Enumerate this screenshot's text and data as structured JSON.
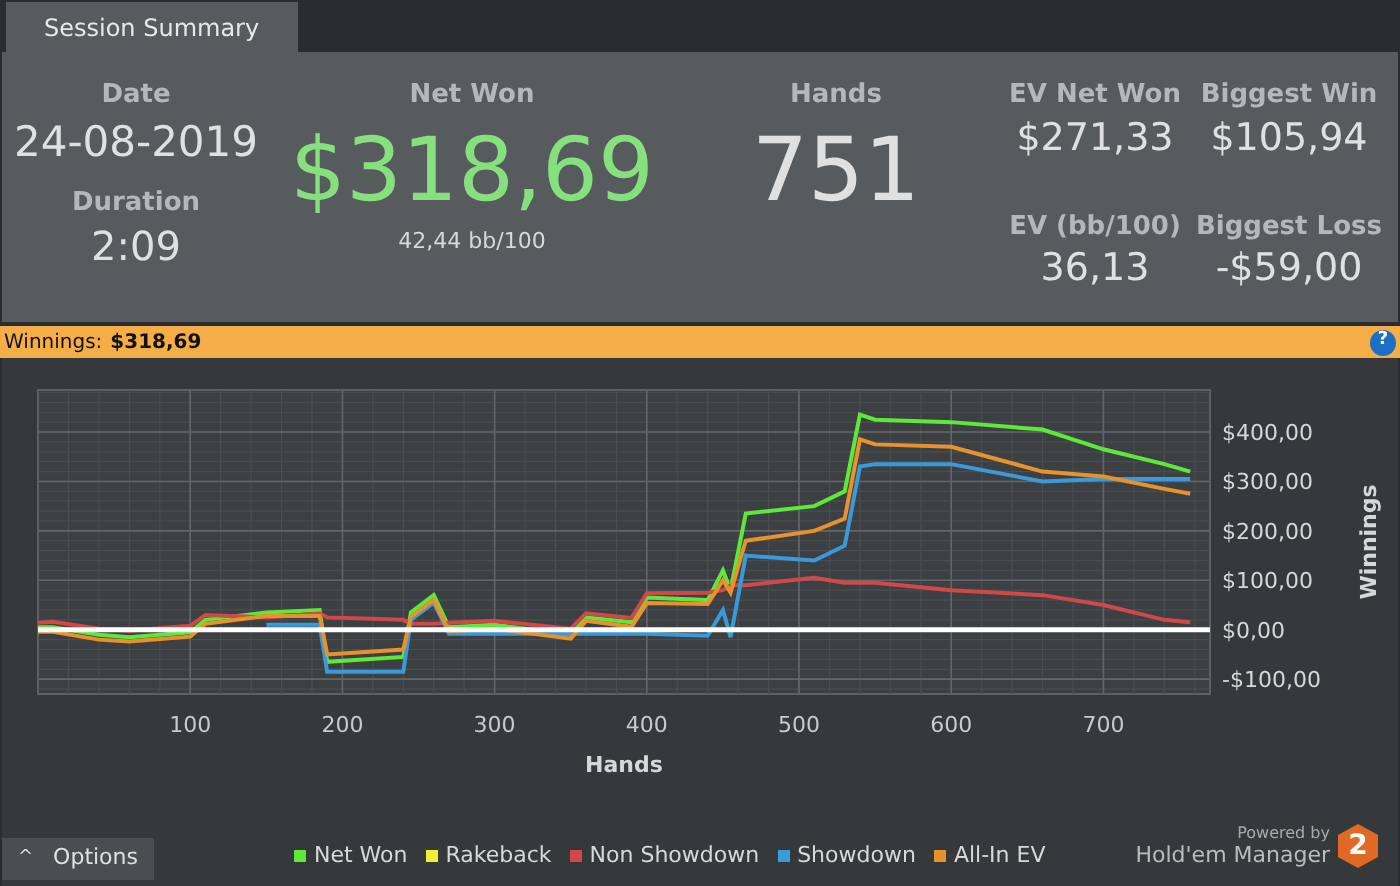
{
  "tabs": [
    {
      "label": "Session Summary",
      "selected": true
    }
  ],
  "summary": {
    "date": {
      "label": "Date",
      "value": "24-08-2019"
    },
    "duration": {
      "label": "Duration",
      "value": "2:09"
    },
    "net_won": {
      "label": "Net Won",
      "value": "$318,69",
      "sub": "42,44 bb/100"
    },
    "hands": {
      "label": "Hands",
      "value": "751"
    },
    "ev_net_won": {
      "label": "EV Net Won",
      "value": "$271,33"
    },
    "biggest_win": {
      "label": "Biggest Win",
      "value": "$105,94"
    },
    "ev_bb": {
      "label": "EV (bb/100)",
      "value": "36,13"
    },
    "biggest_loss": {
      "label": "Biggest Loss",
      "value": "-$59,00"
    }
  },
  "header_bar": {
    "label": "Winnings:",
    "value": "$318,69",
    "help": "?"
  },
  "chart_data": {
    "type": "line",
    "grid": true,
    "xlabel": "Hands",
    "ylabel": "Winnings",
    "xlim": [
      0,
      770
    ],
    "ylim": [
      -130,
      485
    ],
    "xticks": [
      100,
      200,
      300,
      400,
      500,
      600,
      700
    ],
    "yticks": [
      {
        "value": -100,
        "label": "-$100,00"
      },
      {
        "value": 0,
        "label": "$0,00"
      },
      {
        "value": 100,
        "label": "$100,00"
      },
      {
        "value": 200,
        "label": "$200,00"
      },
      {
        "value": 300,
        "label": "$300,00"
      },
      {
        "value": 400,
        "label": "$400,00"
      }
    ],
    "x": [
      0,
      10,
      40,
      60,
      100,
      110,
      150,
      185,
      190,
      240,
      245,
      260,
      270,
      300,
      350,
      360,
      390,
      400,
      440,
      450,
      455,
      465,
      510,
      530,
      540,
      550,
      600,
      660,
      700,
      740,
      757
    ],
    "series": [
      {
        "name": "Net Won",
        "color": "#5ee83a",
        "values": [
          5,
          5,
          -10,
          -15,
          -5,
          20,
          35,
          40,
          -65,
          -55,
          35,
          70,
          5,
          10,
          -10,
          25,
          15,
          65,
          60,
          120,
          80,
          235,
          250,
          280,
          435,
          425,
          420,
          405,
          365,
          335,
          320
        ]
      },
      {
        "name": "Rakeback",
        "color": "#eeee33",
        "values": [
          null,
          null,
          null,
          null,
          null,
          null,
          null,
          null,
          null,
          null,
          null,
          null,
          null,
          null,
          null,
          null,
          null,
          null,
          null,
          null,
          null,
          null,
          null,
          null,
          null,
          null,
          null,
          null,
          null,
          null,
          null
        ]
      },
      {
        "name": "Non Showdown",
        "color": "#d04848",
        "values": [
          14,
          16,
          2,
          -2,
          8,
          30,
          25,
          33,
          25,
          20,
          12,
          12,
          14,
          18,
          2,
          33,
          24,
          74,
          75,
          80,
          90,
          90,
          105,
          95,
          95,
          95,
          80,
          70,
          50,
          20,
          15
        ]
      },
      {
        "name": "Showdown",
        "color": "#3a9ad9",
        "values": [
          null,
          null,
          null,
          null,
          null,
          null,
          10,
          10,
          -85,
          -85,
          20,
          55,
          -8,
          -8,
          -8,
          -8,
          -8,
          -8,
          -12,
          40,
          -15,
          150,
          140,
          170,
          330,
          335,
          335,
          300,
          305,
          305,
          305
        ]
      },
      {
        "name": "All-In EV",
        "color": "#e8922e",
        "values": [
          -4,
          -4,
          -20,
          -24,
          -14,
          12,
          28,
          28,
          -50,
          -40,
          26,
          60,
          -3,
          2,
          -18,
          18,
          6,
          54,
          52,
          100,
          75,
          180,
          200,
          225,
          385,
          375,
          370,
          320,
          310,
          285,
          275
        ]
      }
    ]
  },
  "options_button": {
    "label": "Options",
    "icon": "^"
  },
  "branding": {
    "powered": "Powered by",
    "name": "Hold'em Manager",
    "badge": "2"
  }
}
